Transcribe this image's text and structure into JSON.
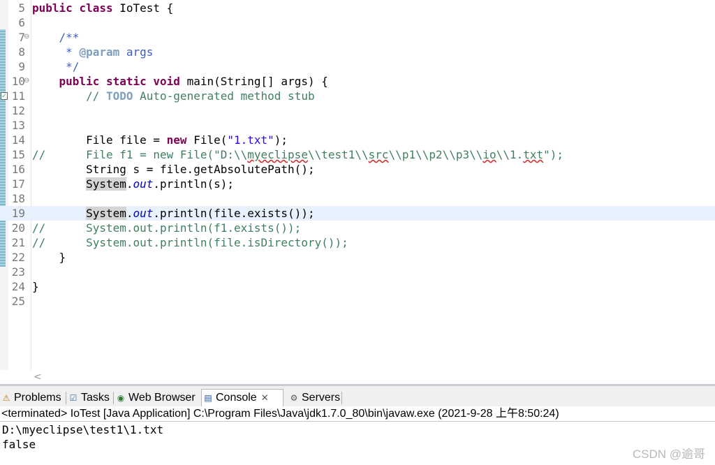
{
  "editor": {
    "lines": [
      {
        "n": "5",
        "fold": "",
        "code": [
          {
            "t": "public",
            "c": "kw"
          },
          {
            "t": " "
          },
          {
            "t": "class",
            "c": "kw"
          },
          {
            "t": " IoTest {"
          }
        ]
      },
      {
        "n": "6",
        "fold": "",
        "code": []
      },
      {
        "n": "7",
        "fold": "⊖",
        "code": [
          {
            "t": "    "
          },
          {
            "t": "/**",
            "c": "jd"
          }
        ]
      },
      {
        "n": "8",
        "fold": "",
        "code": [
          {
            "t": "     "
          },
          {
            "t": "* ",
            "c": "jd"
          },
          {
            "t": "@param",
            "c": "jdtag"
          },
          {
            "t": " args",
            "c": "jd"
          }
        ]
      },
      {
        "n": "9",
        "fold": "",
        "code": [
          {
            "t": "     "
          },
          {
            "t": "*/",
            "c": "jd"
          }
        ]
      },
      {
        "n": "10",
        "fold": "⊖",
        "code": [
          {
            "t": "    "
          },
          {
            "t": "public",
            "c": "kw"
          },
          {
            "t": " "
          },
          {
            "t": "static",
            "c": "kw"
          },
          {
            "t": " "
          },
          {
            "t": "void",
            "c": "kw"
          },
          {
            "t": " main(String[] args) {"
          }
        ]
      },
      {
        "n": "11",
        "fold": "",
        "task": true,
        "code": [
          {
            "t": "        "
          },
          {
            "t": "// ",
            "c": "cm"
          },
          {
            "t": "TODO",
            "c": "todo"
          },
          {
            "t": " Auto-generated method stub",
            "c": "cm"
          }
        ]
      },
      {
        "n": "12",
        "fold": "",
        "code": []
      },
      {
        "n": "13",
        "fold": "",
        "code": []
      },
      {
        "n": "14",
        "fold": "",
        "code": [
          {
            "t": "        File file = "
          },
          {
            "t": "new",
            "c": "kw"
          },
          {
            "t": " File("
          },
          {
            "t": "\"1.txt\"",
            "c": "str"
          },
          {
            "t": ");"
          }
        ]
      },
      {
        "n": "15",
        "fold": "",
        "code": [
          {
            "t": "//      File f1 = new File(\"D:\\\\",
            "c": "cm"
          },
          {
            "t": "myeclipse",
            "c": "cm sq"
          },
          {
            "t": "\\\\test1\\\\",
            "c": "cm"
          },
          {
            "t": "src",
            "c": "cm sq"
          },
          {
            "t": "\\\\p1\\\\p2\\\\p3\\\\",
            "c": "cm"
          },
          {
            "t": "io",
            "c": "cm sq"
          },
          {
            "t": "\\\\1.",
            "c": "cm"
          },
          {
            "t": "txt",
            "c": "cm sq"
          },
          {
            "t": "\");",
            "c": "cm"
          }
        ]
      },
      {
        "n": "16",
        "fold": "",
        "code": [
          {
            "t": "        String s = file.getAbsolutePath();"
          }
        ]
      },
      {
        "n": "17",
        "fold": "",
        "code": [
          {
            "t": "        "
          },
          {
            "t": "System",
            "c": "hl"
          },
          {
            "t": "."
          },
          {
            "t": "out",
            "c": "fld"
          },
          {
            "t": ".println(s);"
          }
        ]
      },
      {
        "n": "18",
        "fold": "",
        "code": []
      },
      {
        "n": "19",
        "fold": "",
        "current": true,
        "code": [
          {
            "t": "        "
          },
          {
            "caret": true
          },
          {
            "t": "System",
            "c": "hl"
          },
          {
            "t": "."
          },
          {
            "t": "out",
            "c": "fld"
          },
          {
            "t": ".println(file.exists());"
          }
        ]
      },
      {
        "n": "20",
        "fold": "",
        "code": [
          {
            "t": "//      System.out.println(f1.exists());",
            "c": "cm"
          }
        ]
      },
      {
        "n": "21",
        "fold": "",
        "code": [
          {
            "t": "//      System.out.println(file.isDirectory());",
            "c": "cm"
          }
        ]
      },
      {
        "n": "22",
        "fold": "",
        "code": [
          {
            "t": "    }"
          }
        ]
      },
      {
        "n": "23",
        "fold": "",
        "code": []
      },
      {
        "n": "24",
        "fold": "",
        "code": [
          {
            "t": "}"
          }
        ]
      },
      {
        "n": "25",
        "fold": "",
        "code": []
      }
    ],
    "scroll_left_icon": "<"
  },
  "tabs": [
    {
      "label": "Problems",
      "icon": "problems-icon",
      "glyph": "⚠",
      "active": false
    },
    {
      "label": "Tasks",
      "icon": "tasks-icon",
      "glyph": "☑",
      "active": false
    },
    {
      "label": "Web Browser",
      "icon": "web-browser-icon",
      "glyph": "◉",
      "active": false
    },
    {
      "label": "Console",
      "icon": "console-icon",
      "glyph": "▤",
      "active": true,
      "close": "✕"
    },
    {
      "label": "Servers",
      "icon": "servers-icon",
      "glyph": "⚙",
      "active": false
    }
  ],
  "console": {
    "header": "<terminated> IoTest [Java Application] C:\\Program Files\\Java\\jdk1.7.0_80\\bin\\javaw.exe (2021-9-28 上午8:50:24)",
    "output": [
      "D:\\myeclipse\\test1\\1.txt",
      "false"
    ]
  },
  "watermark": "CSDN @逾哥",
  "colors": {
    "keyword": "#7f0055",
    "string": "#2a00ff",
    "comment": "#3f7f5f",
    "javadoc": "#3f5fbf",
    "field": "#0000c0",
    "current_line": "#e8f2fe"
  }
}
